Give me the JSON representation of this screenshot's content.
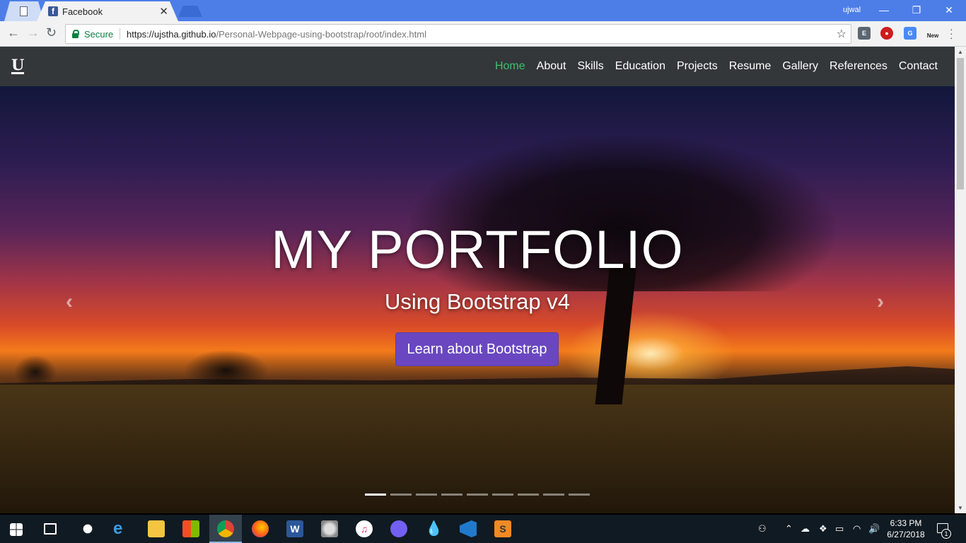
{
  "browser": {
    "tab_title": "Facebook",
    "user_name": "ujwal",
    "secure_label": "Secure",
    "url_host": "https://ujstha.github.io",
    "url_path": "/Personal-Webpage-using-bootstrap/root/index.html",
    "new_badge": "New"
  },
  "site": {
    "brand": "U",
    "nav": [
      {
        "label": "Home",
        "active": true
      },
      {
        "label": "About"
      },
      {
        "label": "Skills"
      },
      {
        "label": "Education"
      },
      {
        "label": "Projects"
      },
      {
        "label": "Resume"
      },
      {
        "label": "Gallery"
      },
      {
        "label": "References"
      },
      {
        "label": "Contact"
      }
    ],
    "hero": {
      "title": "MY PORTFOLIO",
      "subtitle": "Using Bootstrap v4",
      "button": "Learn about Bootstrap",
      "active_slide": 1,
      "slide_count": 9
    },
    "accent_color": "#3fbf6f",
    "button_color": "#6a47c0"
  },
  "taskbar": {
    "time": "6:33 PM",
    "date": "6/27/2018",
    "notification_count": "1"
  }
}
